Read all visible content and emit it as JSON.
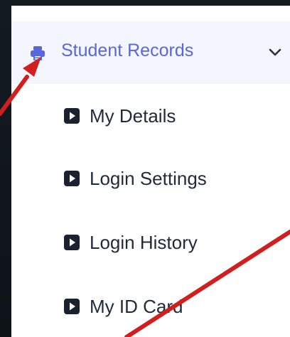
{
  "menu": {
    "header": {
      "label": "Student Records",
      "icon": "printer-icon",
      "expanded": true,
      "accent_color": "#5a66dd",
      "background_color": "#f3f5ff"
    },
    "items": [
      {
        "label": "My Details",
        "icon": "play-square-icon"
      },
      {
        "label": "Login Settings",
        "icon": "play-square-icon"
      },
      {
        "label": "Login History",
        "icon": "play-square-icon"
      },
      {
        "label": "My ID Card",
        "icon": "play-square-icon"
      }
    ]
  },
  "annotations": {
    "arrow_color": "#d11f1f"
  }
}
